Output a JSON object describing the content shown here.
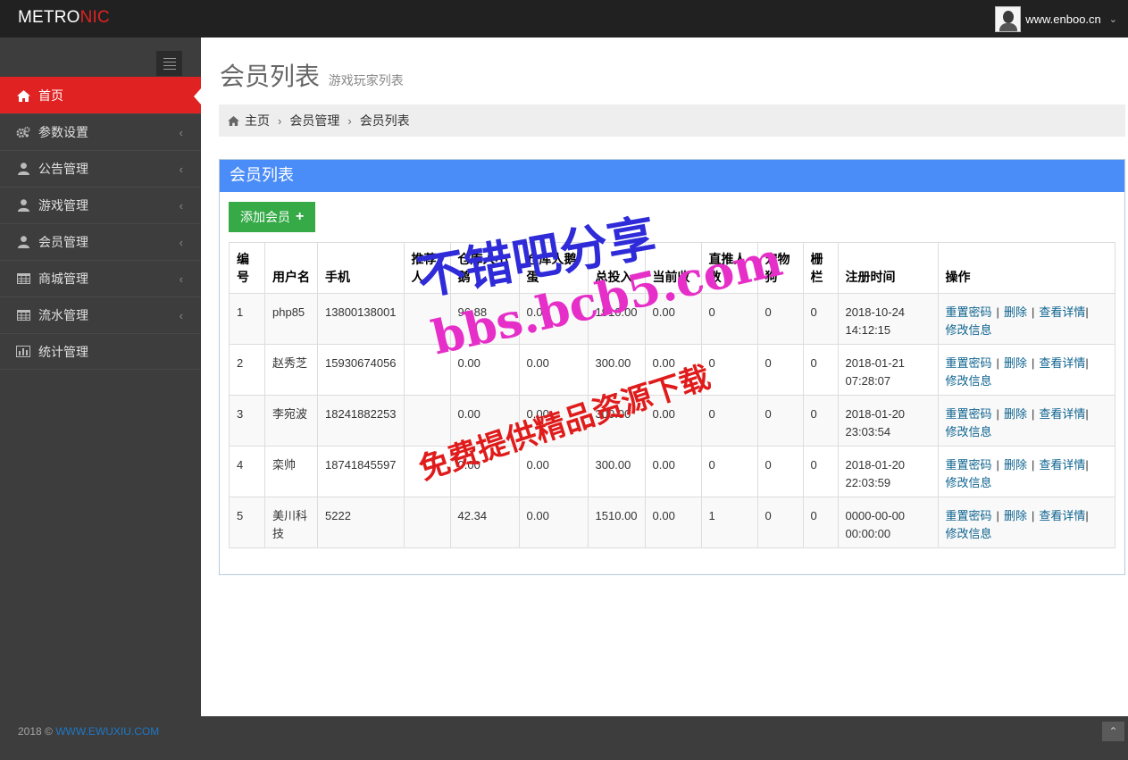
{
  "header": {
    "logo_main": "METRO",
    "logo_accent": "NIC",
    "username": "www.enboo.cn"
  },
  "sidebar": {
    "items": [
      {
        "label": "首页",
        "icon": "home-icon",
        "active": true
      },
      {
        "label": "参数设置",
        "icon": "cogs-icon"
      },
      {
        "label": "公告管理",
        "icon": "user-icon"
      },
      {
        "label": "游戏管理",
        "icon": "user-icon"
      },
      {
        "label": "会员管理",
        "icon": "user-icon"
      },
      {
        "label": "商城管理",
        "icon": "table-icon"
      },
      {
        "label": "流水管理",
        "icon": "table-icon"
      },
      {
        "label": "统计管理",
        "icon": "bar-chart-icon"
      }
    ]
  },
  "page": {
    "title": "会员列表",
    "subtitle": "游戏玩家列表"
  },
  "breadcrumb": {
    "home": "主页",
    "level1": "会员管理",
    "level2": "会员列表"
  },
  "portlet": {
    "title": "会员列表",
    "add_label": "添加会员"
  },
  "table": {
    "headers": [
      "编号",
      "用户名",
      "手机",
      "推荐人",
      "仓库人小鹅",
      "仓库人鹅蛋",
      "总投入",
      "当前收",
      "直推人数",
      "宠物狗",
      "栅栏",
      "注册时间",
      "操作"
    ],
    "rows": [
      {
        "id": "1",
        "user": "php85",
        "phone": "13800138001",
        "ref": "",
        "geese": "96.88",
        "eggs": "0.00",
        "invest": "1910.00",
        "income": "0.00",
        "direct": "0",
        "dogs": "0",
        "fence": "0",
        "date": "2018-10-24",
        "time": "14:12:15"
      },
      {
        "id": "2",
        "user": "赵秀芝",
        "phone": "15930674056",
        "ref": "",
        "geese": "0.00",
        "eggs": "0.00",
        "invest": "300.00",
        "income": "0.00",
        "direct": "0",
        "dogs": "0",
        "fence": "0",
        "date": "2018-01-21",
        "time": "07:28:07"
      },
      {
        "id": "3",
        "user": "李宛波",
        "phone": "18241882253",
        "ref": "",
        "geese": "0.00",
        "eggs": "0.00",
        "invest": "300.00",
        "income": "0.00",
        "direct": "0",
        "dogs": "0",
        "fence": "0",
        "date": "2018-01-20",
        "time": "23:03:54"
      },
      {
        "id": "4",
        "user": "栾帅",
        "phone": "18741845597",
        "ref": "",
        "geese": "0.00",
        "eggs": "0.00",
        "invest": "300.00",
        "income": "0.00",
        "direct": "0",
        "dogs": "0",
        "fence": "0",
        "date": "2018-01-20",
        "time": "22:03:59"
      },
      {
        "id": "5",
        "user": "美川科技",
        "phone": "5222",
        "ref": "",
        "geese": "42.34",
        "eggs": "0.00",
        "invest": "1510.00",
        "income": "0.00",
        "direct": "1",
        "dogs": "0",
        "fence": "0",
        "date": "0000-00-00",
        "time": "00:00:00"
      }
    ],
    "ops": {
      "reset": "重置密码",
      "del": "删除",
      "view": "查看详情",
      "edit": "修改信息",
      "separator": "|"
    }
  },
  "watermark": {
    "line1": "不错吧分享",
    "line2": "bbs.bcb5.com",
    "line3": "免费提供精品资源下载"
  },
  "footer": {
    "year": "2018 ©",
    "link": "WWW.EWUXIU.COM"
  },
  "colors": {
    "active_menu": "#e02222",
    "portlet_header": "#4b8df8",
    "add_button": "#35aa47",
    "link": "#0d638f"
  }
}
